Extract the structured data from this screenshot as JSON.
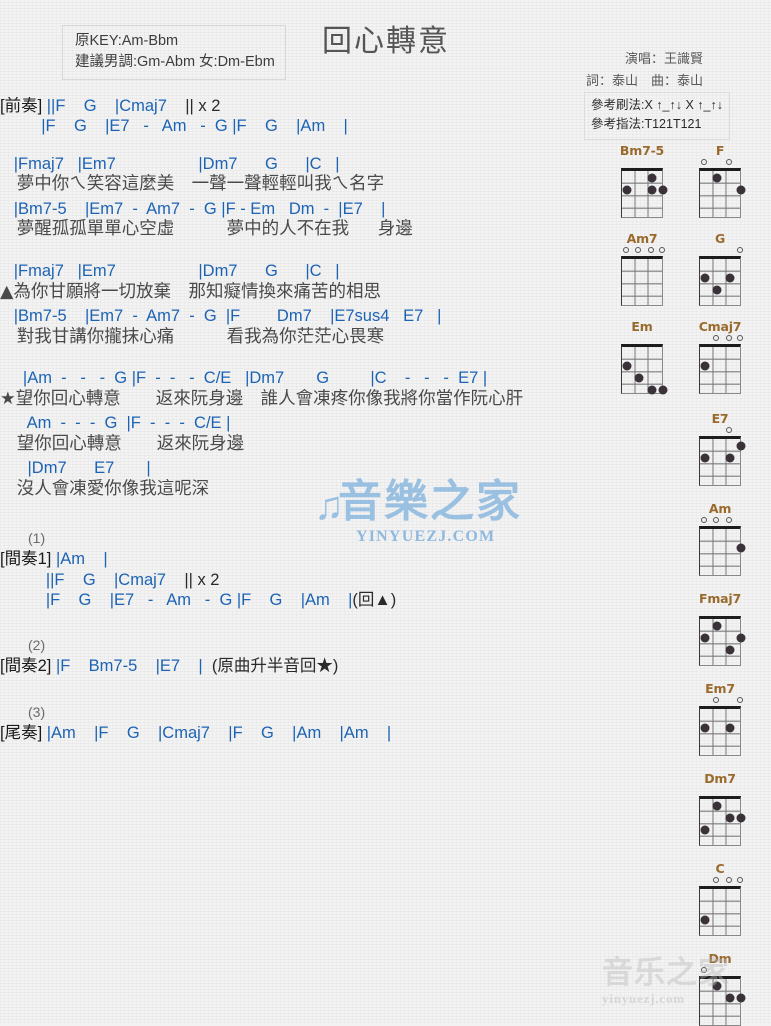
{
  "header": {
    "title": "回心轉意",
    "key_line1": "原KEY:Am-Bbm",
    "key_line2": "建議男調:Gm-Abm 女:Dm-Ebm",
    "singer": "演唱：王識賢",
    "writer": "詞：泰山　曲：泰山",
    "strum": "參考刷法:X ↑_↑↓ X ↑_↑↓",
    "finger": "參考指法:T121T121"
  },
  "watermark": {
    "cn": "音樂之家",
    "en": "YINYUEZJ.COM",
    "bottom_cn": "音乐之家",
    "bottom_en": "yinyuezj.com"
  },
  "sections": [
    {
      "type": "chord",
      "text": "[前奏] ||F    G    |Cmaj7    || x 2"
    },
    {
      "type": "chord",
      "text": "         |F    G    |E7   -   Am   -  G |F    G    |Am    |"
    },
    {
      "type": "gap",
      "size": "md"
    },
    {
      "type": "chord",
      "text": "   |Fmaj7   |Em7                  |Dm7      G      |C   |"
    },
    {
      "type": "lyric",
      "text": "   夢中你ㄟ笑容這麼美　一聲一聲輕輕叫我ㄟ名字"
    },
    {
      "type": "chord",
      "text": "   |Bm7-5    |Em7  -  Am7  -  G |F - Em   Dm  -  |E7    |"
    },
    {
      "type": "lyric",
      "text": "   夢醒孤孤單單心空虛　　　夢中的人不在我　  身邊"
    },
    {
      "type": "gap",
      "size": "md"
    },
    {
      "type": "chord",
      "text": "   |Fmaj7   |Em7                  |Dm7      G      |C   |"
    },
    {
      "type": "lyric",
      "text": "▲為你甘願將一切放棄　那知癡情換來痛苦的相思"
    },
    {
      "type": "chord",
      "text": "   |Bm7-5    |Em7  -  Am7  -  G  |F        Dm7    |E7sus4   E7   |"
    },
    {
      "type": "lyric",
      "text": "   對我甘講你攏抹心痛　　　看我為你茫茫心畏寒"
    },
    {
      "type": "gap",
      "size": "md"
    },
    {
      "type": "chord",
      "text": "     |Am  -   -   -  G |F  -  -   -  C/E   |Dm7       G         |C    -   -   -  E7 |"
    },
    {
      "type": "lyric",
      "text": "★望你回心轉意　　返來阮身邊　誰人會凍疼你像我將你當作阮心肝"
    },
    {
      "type": "chord",
      "text": "      Am  -  -  -  G  |F  -  -  -  C/E |"
    },
    {
      "type": "lyric",
      "text": "   望你回心轉意　　返來阮身邊"
    },
    {
      "type": "chord",
      "text": "      |Dm7      E7       |"
    },
    {
      "type": "lyric",
      "text": "   沒人會凍愛你像我這呢深"
    },
    {
      "type": "gap",
      "size": "lg"
    },
    {
      "type": "note",
      "text": "(1)"
    },
    {
      "type": "chord",
      "text": "[間奏1] |Am    |"
    },
    {
      "type": "chord",
      "text": "          ||F    G    |Cmaj7    || x 2"
    },
    {
      "type": "chord",
      "text": "          |F    G    |E7   -   Am   -  G |F    G    |Am    |(回▲)"
    },
    {
      "type": "gap",
      "size": "lg"
    },
    {
      "type": "note",
      "text": "(2)"
    },
    {
      "type": "chord",
      "text": "[間奏2] |F    Bm7-5    |E7    |  (原曲升半音回★)"
    },
    {
      "type": "gap",
      "size": "lg"
    },
    {
      "type": "note",
      "text": "(3)"
    },
    {
      "type": "chord",
      "text": "[尾奏] |Am    |F    G    |Cmaj7    |F    G    |Am    |Am    |"
    }
  ],
  "diagrams": [
    {
      "name": "Bm7-5",
      "col": 0,
      "row": 0,
      "opens": [],
      "dots": [
        {
          "s": 3,
          "f": 1
        },
        {
          "s": 4,
          "f": 2
        },
        {
          "s": 3,
          "f": 2
        },
        {
          "s": 1,
          "f": 2
        }
      ]
    },
    {
      "name": "F",
      "col": 1,
      "row": 0,
      "opens": [
        3,
        1
      ],
      "dots": [
        {
          "s": 2,
          "f": 1
        },
        {
          "s": 4,
          "f": 2
        }
      ]
    },
    {
      "name": "Am7",
      "col": 0,
      "row": 1,
      "opens": [
        4,
        3,
        2,
        1
      ],
      "dots": []
    },
    {
      "name": "G",
      "col": 1,
      "row": 1,
      "opens": [
        4
      ],
      "dots": [
        {
          "s": 3,
          "f": 2
        },
        {
          "s": 1,
          "f": 2
        },
        {
          "s": 2,
          "f": 3
        }
      ]
    },
    {
      "name": "Em",
      "col": 0,
      "row": 2,
      "opens": [],
      "dots": [
        {
          "s": 1,
          "f": 2
        },
        {
          "s": 2,
          "f": 3
        },
        {
          "s": 4,
          "f": 4
        },
        {
          "s": 3,
          "f": 4
        }
      ]
    },
    {
      "name": "Cmaj7",
      "col": 1,
      "row": 2,
      "opens": [
        4,
        3,
        2
      ],
      "dots": [
        {
          "s": 1,
          "f": 2
        }
      ]
    },
    {
      "name": "E7",
      "col": 1,
      "row": 3,
      "opens": [
        3
      ],
      "dots": [
        {
          "s": 4,
          "f": 1
        },
        {
          "s": 3,
          "f": 2
        },
        {
          "s": 1,
          "f": 2
        }
      ]
    },
    {
      "name": "Am",
      "col": 1,
      "row": 4,
      "opens": [
        3,
        2,
        1
      ],
      "dots": [
        {
          "s": 4,
          "f": 2
        }
      ]
    },
    {
      "name": "Fmaj7",
      "col": 1,
      "row": 5,
      "opens": [],
      "dots": [
        {
          "s": 2,
          "f": 1
        },
        {
          "s": 4,
          "f": 2
        },
        {
          "s": 1,
          "f": 2
        },
        {
          "s": 3,
          "f": 3
        }
      ]
    },
    {
      "name": "Em7",
      "col": 1,
      "row": 6,
      "opens": [
        4,
        2
      ],
      "dots": [
        {
          "s": 3,
          "f": 2
        },
        {
          "s": 1,
          "f": 2
        }
      ]
    },
    {
      "name": "Dm7",
      "col": 1,
      "row": 7,
      "opens": [],
      "dots": [
        {
          "s": 2,
          "f": 1
        },
        {
          "s": 4,
          "f": 2
        },
        {
          "s": 3,
          "f": 2
        },
        {
          "s": 1,
          "f": 3
        }
      ]
    },
    {
      "name": "C",
      "col": 1,
      "row": 8,
      "opens": [
        4,
        3,
        2
      ],
      "dots": [
        {
          "s": 1,
          "f": 3
        }
      ]
    },
    {
      "name": "Dm",
      "col": 1,
      "row": 9,
      "opens": [
        1
      ],
      "dots": [
        {
          "s": 2,
          "f": 1
        },
        {
          "s": 4,
          "f": 2
        },
        {
          "s": 3,
          "f": 2
        }
      ]
    }
  ]
}
